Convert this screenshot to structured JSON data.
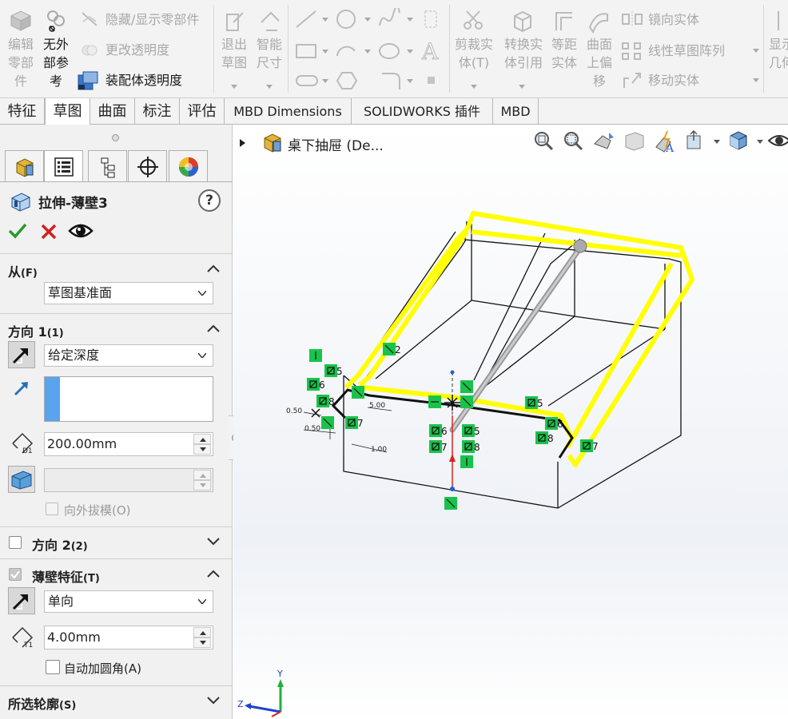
{
  "ribbon": {
    "edit_part": [
      "编辑",
      "零部",
      "件"
    ],
    "no_external": [
      "无外",
      "部参",
      "考"
    ],
    "hide_show": "隐藏/显示零部件",
    "change_transparency": "更改透明度",
    "assembly_transparency": "装配体透明度",
    "exit_sketch": [
      "退出",
      "草图"
    ],
    "smart_dimension": [
      "智能",
      "尺寸"
    ],
    "trim_entities": [
      "剪裁实",
      "体(T)"
    ],
    "convert_entities": [
      "转换实",
      "体引用"
    ],
    "offset_entities": [
      "等距",
      "实体"
    ],
    "offset_on_surface": [
      "曲面",
      "上偏",
      "移"
    ],
    "mirror_entities": "镜向实体",
    "linear_pattern": "线性草图阵列",
    "move_entities": "移动实体",
    "display_relations": [
      "显示",
      "几何"
    ]
  },
  "tabs": [
    "特征",
    "草图",
    "曲面",
    "标注",
    "评估",
    "MBD Dimensions",
    "SOLIDWORKS 插件",
    "MBD"
  ],
  "active_tab": "草图",
  "panel": {
    "title": "拉伸-薄壁3",
    "help": "?",
    "from": {
      "header": "从",
      "key": "(F)",
      "value": "草图基准面"
    },
    "dir1": {
      "header": "方向 1",
      "key": "(1)",
      "end_condition": "给定深度",
      "depth_label": "D1",
      "depth": "200.00mm",
      "draft_outward": "向外拔模(O)"
    },
    "dir2": {
      "header": "方向 2",
      "key": "(2)"
    },
    "thin": {
      "header": "薄壁特征",
      "key": "(T)",
      "type": "单向",
      "thickness_label": "T1",
      "thickness": "4.00mm",
      "auto_fillet": "自动加圆角(A)"
    },
    "selected_contours": {
      "header": "所选轮廓",
      "key": "(S)"
    }
  },
  "viewport": {
    "tree_item": "桌下抽屉 (De...",
    "dimensions": {
      "d050a": "0.50",
      "d050b": "0.50",
      "d500": "5.00",
      "d100": "1.00"
    },
    "relation_labels": {
      "r2": "2",
      "r5a": "5",
      "r6a": "6",
      "r8a": "8",
      "r7a": "7",
      "r5b": "5",
      "r6b": "6",
      "r7b": "7",
      "r8b": "8",
      "r5c": "5",
      "r6c": "6",
      "r8c": "8",
      "r7c": "7"
    },
    "triad": {
      "y": "Y",
      "z": "Z"
    }
  },
  "colors": {
    "highlight": "#ffff00",
    "relation_green": "#19c34b",
    "origin_red": "#e02020",
    "ok_green": "#2a9a2a",
    "cancel_red": "#d02020"
  }
}
